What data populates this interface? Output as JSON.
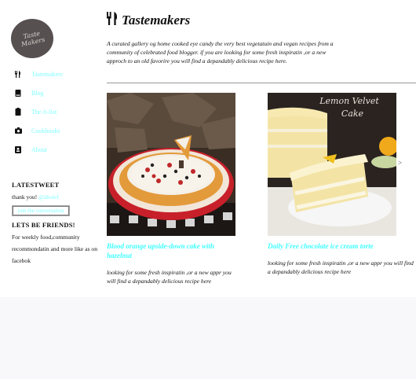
{
  "logo": {
    "line1": "Taste",
    "line2": "Makers"
  },
  "nav": [
    {
      "label": "Tastemakers",
      "icon": "fork-knife-icon"
    },
    {
      "label": "Blog",
      "icon": "book-icon"
    },
    {
      "label": "The A-list",
      "icon": "clipboard-icon"
    },
    {
      "label": "Cookbooks",
      "icon": "camera-icon"
    },
    {
      "label": "About",
      "icon": "contact-card-icon"
    }
  ],
  "latest_tweet": {
    "title": "LATESTWEET",
    "text": "thank you!",
    "handle": "@abolef",
    "join_label": "join the conversation"
  },
  "friends": {
    "title": "LETS BE FRIENDS!",
    "text": "For weekly food,community recommondatin and more like as on facebok"
  },
  "header": {
    "title": "Tastemakers",
    "icon": "fork-knife-icon"
  },
  "intro": "A curated gallery og home cooked eye candy the very best vegetatuin and vegan recipes from a community of celebrated food blogger. if you are looking for some fresh inspiratin ,or a new approch to an old favorire you will find a depandably delicious recipe here.",
  "cards": [
    {
      "title": "Blood orange upside-down cake with hazelnut",
      "desc": "looking for some fresh inspiratin ,or a new appr you will find a depandably delicious recipe here"
    },
    {
      "title": "Daily Free chocolate ice cream torte",
      "desc": "looking for some fresh inspiratin ,or a new appr you will find a depandably delicious recipe here"
    }
  ],
  "card2_image_text": {
    "line1": "Lemon Velvet",
    "line2": "Cake"
  },
  "carousel_arrow": ">",
  "colors": {
    "link": "#80ffff",
    "card_title": "#40ffff",
    "logo_bg": "#575050"
  }
}
